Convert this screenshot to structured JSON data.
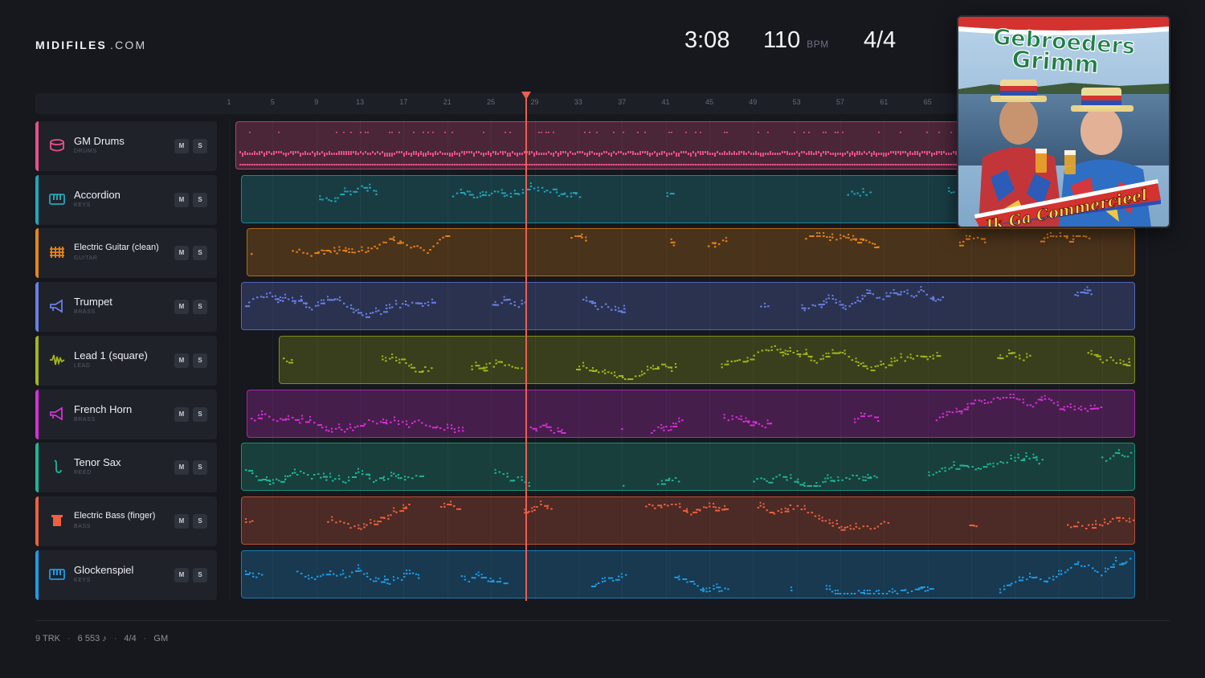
{
  "brand": {
    "name": "MIDIFILES",
    "domain": ".COM"
  },
  "transport": {
    "time": "3:08",
    "tempo": "110",
    "tempo_unit": "BPM",
    "time_signature": "4/4"
  },
  "ruler": {
    "bars": [
      "1",
      "5",
      "9",
      "13",
      "17",
      "21",
      "25",
      "29",
      "33",
      "37",
      "41",
      "45",
      "49",
      "53",
      "57",
      "61",
      "65"
    ]
  },
  "playhead": {
    "bar": 28
  },
  "tracks": [
    {
      "name": "GM Drums",
      "category": "DRUMS",
      "color": "#e8508a",
      "icon": "drum-icon",
      "mute": "M",
      "solo": "S",
      "clip_start_bar": 1,
      "clip_end_bar": 84
    },
    {
      "name": "Accordion",
      "category": "KEYS",
      "color": "#22a6b8",
      "icon": "keyboard-icon",
      "mute": "M",
      "solo": "S",
      "clip_start_bar": 1.5,
      "clip_end_bar": 84
    },
    {
      "name": "Electric Guitar (clean)",
      "category": "GUITAR",
      "color": "#e88418",
      "icon": "guitar-icon",
      "mute": "M",
      "solo": "S",
      "clip_start_bar": 2,
      "clip_end_bar": 84
    },
    {
      "name": "Trumpet",
      "category": "BRASS",
      "color": "#6a7fe8",
      "icon": "horn-icon",
      "mute": "M",
      "solo": "S",
      "clip_start_bar": 1.5,
      "clip_end_bar": 84
    },
    {
      "name": "Lead 1 (square)",
      "category": "LEAD",
      "color": "#a3b51c",
      "icon": "wave-icon",
      "mute": "M",
      "solo": "S",
      "clip_start_bar": 5,
      "clip_end_bar": 84
    },
    {
      "name": "French Horn",
      "category": "BRASS",
      "color": "#d62fd8",
      "icon": "horn-icon",
      "mute": "M",
      "solo": "S",
      "clip_start_bar": 2,
      "clip_end_bar": 84
    },
    {
      "name": "Tenor Sax",
      "category": "REED",
      "color": "#1fb599",
      "icon": "sax-icon",
      "mute": "M",
      "solo": "S",
      "clip_start_bar": 1.5,
      "clip_end_bar": 84
    },
    {
      "name": "Electric Bass (finger)",
      "category": "BASS",
      "color": "#f0603e",
      "icon": "bass-icon",
      "mute": "M",
      "solo": "S",
      "clip_start_bar": 1.5,
      "clip_end_bar": 84
    },
    {
      "name": "Glockenspiel",
      "category": "KEYS",
      "color": "#1f9ae6",
      "icon": "keyboard-icon",
      "mute": "M",
      "solo": "S",
      "clip_start_bar": 1.5,
      "clip_end_bar": 84
    }
  ],
  "album": {
    "artist": "Gebroeders Grimm",
    "title": "Ik Ga Commercieel"
  },
  "footer": {
    "tracks": "9 TRK",
    "notes": "6 553 ♪",
    "time_signature": "4/4",
    "standard": "GM"
  }
}
